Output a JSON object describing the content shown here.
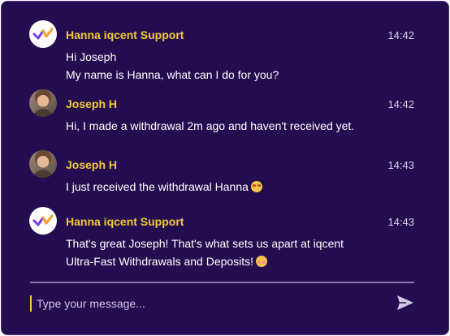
{
  "chat": {
    "messages": [
      {
        "author": "Hanna iqcent Support",
        "time": "14:42",
        "avatar": "brand-logo-icon",
        "lines": [
          "Hi Joseph",
          "My name is Hanna, what can I do for you?"
        ]
      },
      {
        "author": "Joseph H",
        "time": "14:42",
        "avatar": "user-photo",
        "lines": [
          "Hi, I made a withdrawal 2m ago and haven't received yet."
        ]
      },
      {
        "author": "Joseph H",
        "time": "14:43",
        "avatar": "user-photo",
        "lines": [
          "I just received the withdrawal Hanna"
        ],
        "emoji": "star-struck-emoji"
      },
      {
        "author": "Hanna iqcent Support",
        "time": "14:43",
        "avatar": "brand-logo-icon",
        "lines": [
          "That's great Joseph! That's what sets us apart at iqcent",
          "Ultra-Fast Withdrawals and Deposits!"
        ],
        "emoji": "smiling-hearts-emoji"
      }
    ]
  },
  "composer": {
    "placeholder": "Type your message...",
    "send_icon": "send-icon"
  },
  "colors": {
    "background": "#230d50",
    "author": "#f3c934",
    "text": "#ffffff",
    "caret": "#f3c934"
  }
}
